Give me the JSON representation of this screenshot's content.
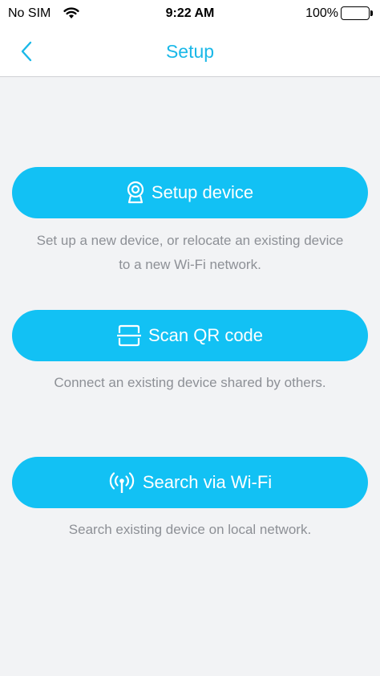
{
  "status_bar": {
    "carrier": "No SIM",
    "time": "9:22 AM",
    "battery_percent": "100%",
    "battery_level": 1.0
  },
  "nav": {
    "title": "Setup",
    "back_icon": "chevron-left-icon"
  },
  "colors": {
    "accent": "#12c1f4",
    "title_color": "#1ab8e8",
    "description_text": "#8d9096",
    "background": "#f2f3f5"
  },
  "actions": [
    {
      "label": "Setup device",
      "icon": "camera-icon",
      "description": "Set up a new device, or relocate an existing device to a new Wi-Fi network."
    },
    {
      "label": "Scan QR code",
      "icon": "scan-icon",
      "description": "Connect an existing device shared by others."
    },
    {
      "label": "Search via Wi-Fi",
      "icon": "wifi-antenna-icon",
      "description": "Search existing device on local network."
    }
  ]
}
